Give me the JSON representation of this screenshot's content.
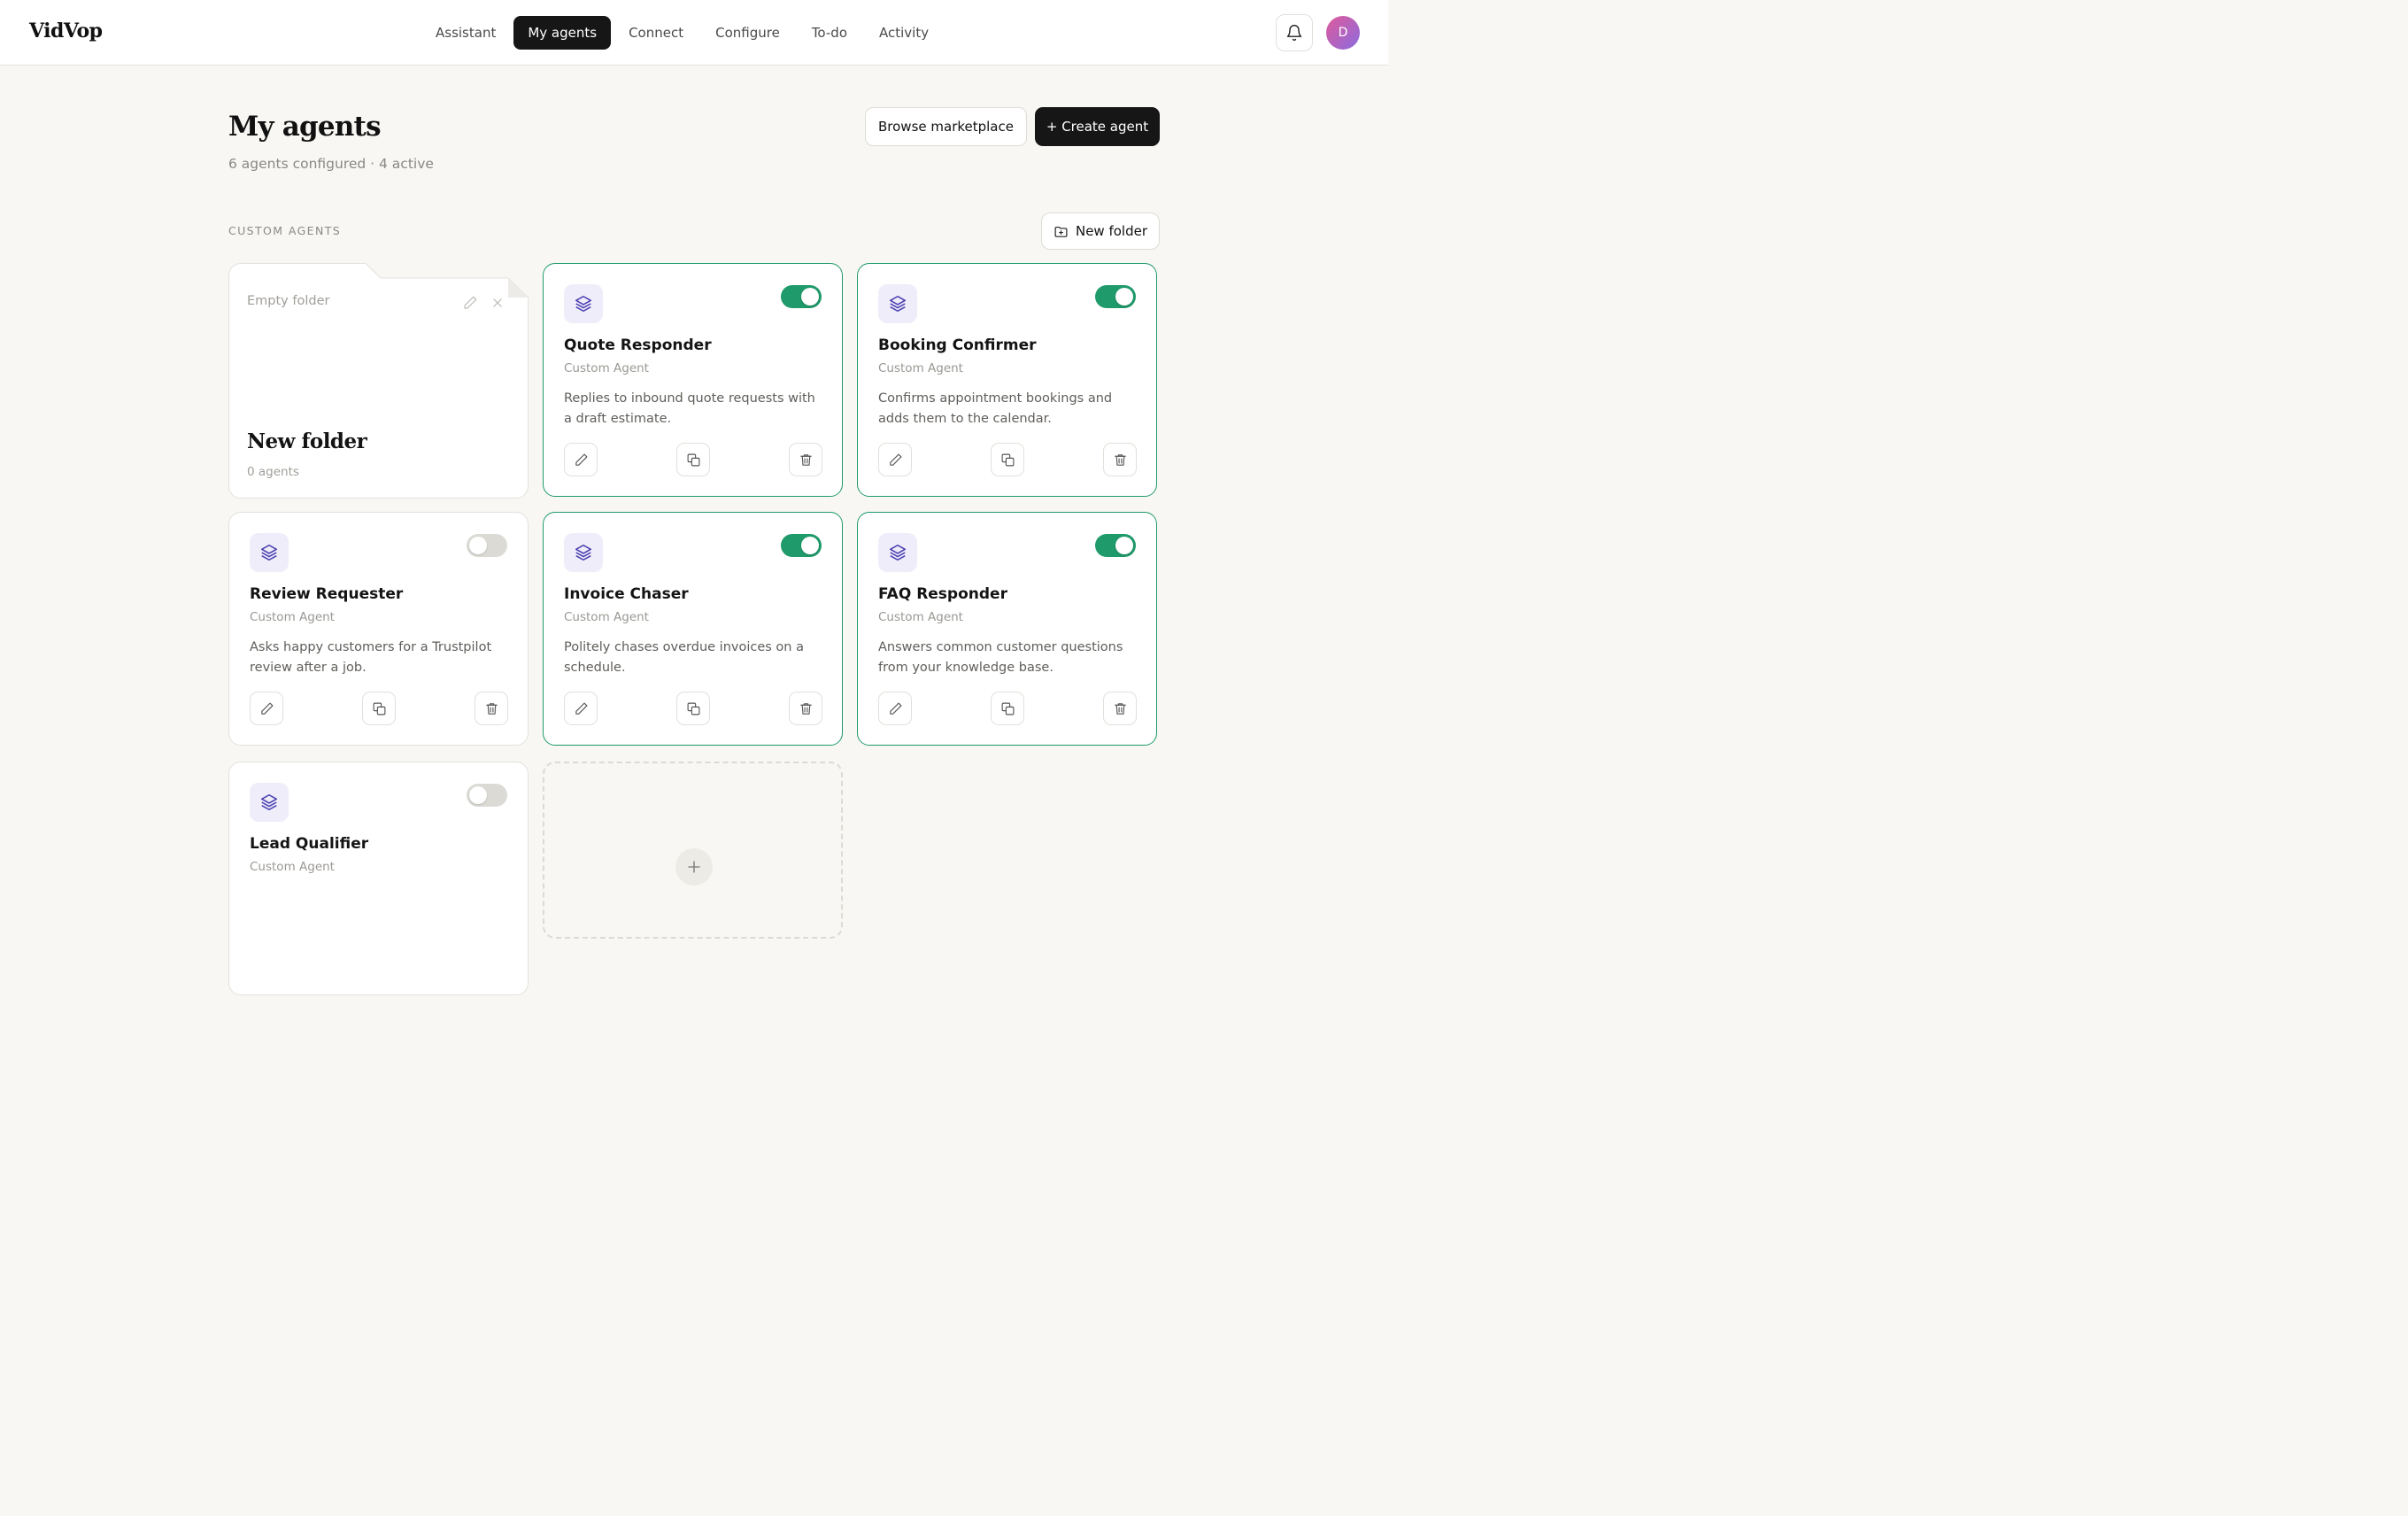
{
  "app": {
    "logo": "VidVop",
    "avatar_initial": "D",
    "accent_color": "#1f9a6a"
  },
  "nav": {
    "items": [
      {
        "label": "Assistant",
        "active": false
      },
      {
        "label": "My agents",
        "active": true
      },
      {
        "label": "Connect",
        "active": false
      },
      {
        "label": "Configure",
        "active": false
      },
      {
        "label": "To-do",
        "active": false
      },
      {
        "label": "Activity",
        "active": false
      }
    ]
  },
  "header": {
    "title": "My agents",
    "subtitle": "6 agents configured · 4 active",
    "browse_label": "Browse marketplace",
    "create_label": "+ Create agent"
  },
  "section": {
    "label": "CUSTOM AGENTS",
    "new_folder_label": "New folder"
  },
  "folder": {
    "placeholder": "Empty folder",
    "title": "New folder",
    "count": "0 agents"
  },
  "agents": [
    {
      "name": "Quote Responder",
      "kind": "Custom Agent",
      "description": "Replies to inbound quote requests with a draft estimate.",
      "enabled": true
    },
    {
      "name": "Booking Confirmer",
      "kind": "Custom Agent",
      "description": "Confirms appointment bookings and adds them to the calendar.",
      "enabled": true
    },
    {
      "name": "Review Requester",
      "kind": "Custom Agent",
      "description": "Asks happy customers for a Trustpilot review after a job.",
      "enabled": false
    },
    {
      "name": "Invoice Chaser",
      "kind": "Custom Agent",
      "description": "Politely chases overdue invoices on a schedule.",
      "enabled": true
    },
    {
      "name": "FAQ Responder",
      "kind": "Custom Agent",
      "description": "Answers common customer questions from your knowledge base.",
      "enabled": true
    },
    {
      "name": "Lead Qualifier",
      "kind": "Custom Agent",
      "description": "",
      "enabled": false
    }
  ]
}
